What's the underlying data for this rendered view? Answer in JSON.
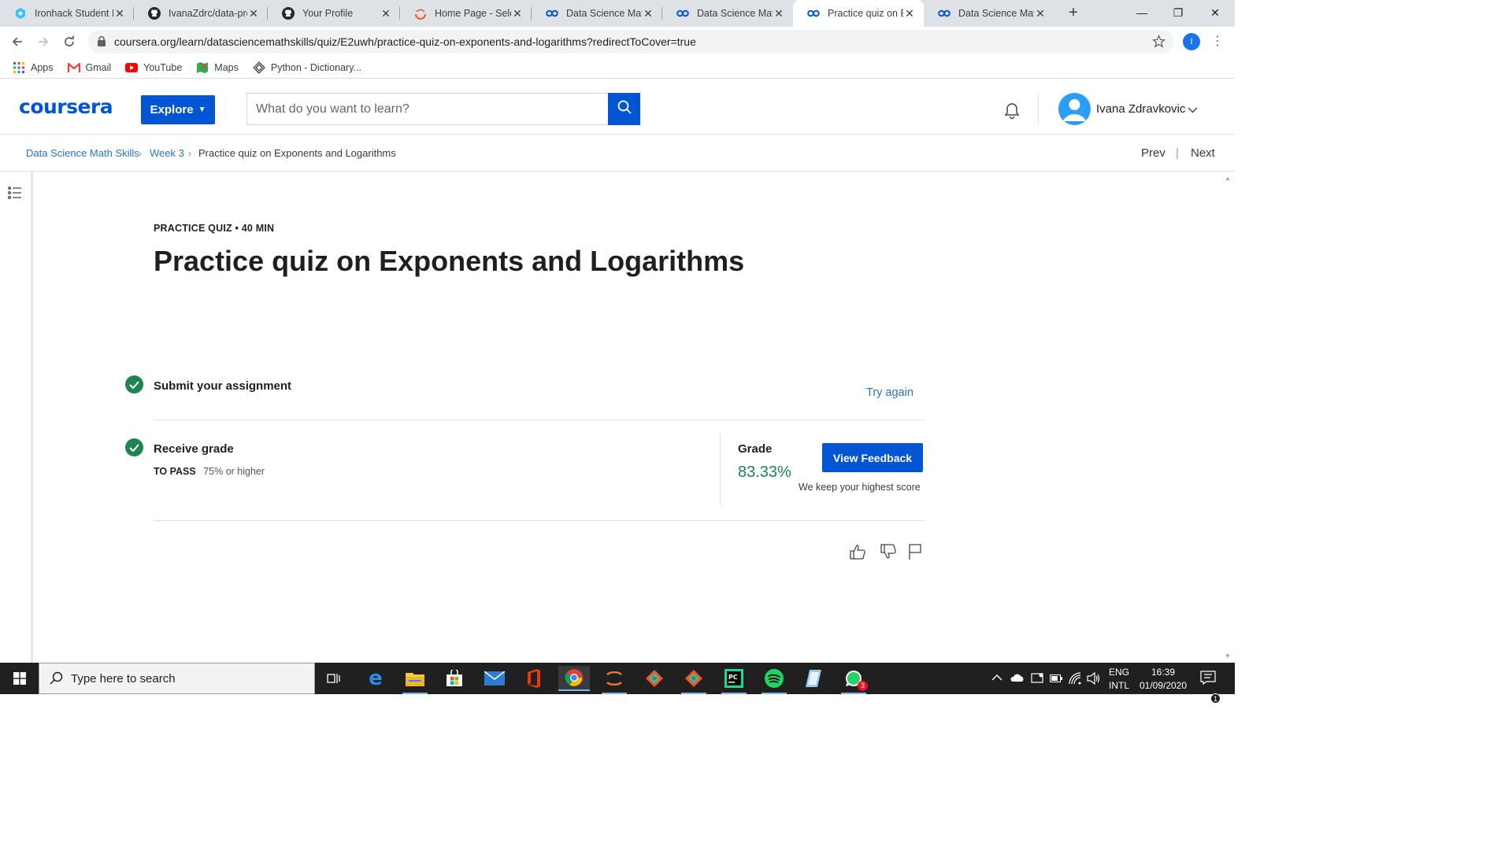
{
  "browser": {
    "tabs": [
      {
        "title": "Ironhack Student P",
        "icon": "ironhack-icon"
      },
      {
        "title": "IvanaZdrc/data-pro",
        "icon": "github-icon"
      },
      {
        "title": "Your Profile",
        "icon": "github-icon"
      },
      {
        "title": "Home Page - Selen",
        "icon": "selenium-icon"
      },
      {
        "title": "Data Science Math",
        "icon": "coursera-icon"
      },
      {
        "title": "Data Science Math",
        "icon": "coursera-icon"
      },
      {
        "title": "Practice quiz on Ex",
        "icon": "coursera-icon",
        "active": true
      },
      {
        "title": "Data Science Math",
        "icon": "coursera-icon"
      }
    ],
    "new_tab": "+",
    "url": "coursera.org/learn/datasciencemathskills/quiz/E2uwh/practice-quiz-on-exponents-and-logarithms?redirectToCover=true",
    "profile_initial": "I",
    "bookmarks": [
      "Apps",
      "Gmail",
      "YouTube",
      "Maps",
      "Python - Dictionary..."
    ]
  },
  "header": {
    "logo": "coursera",
    "explore_label": "Explore",
    "search_placeholder": "What do you want to learn?",
    "user_name": "Ivana Zdravkovic"
  },
  "breadcrumb": {
    "items": [
      "Data Science Math Skills",
      "Week 3",
      "Practice quiz on Exponents and Logarithms"
    ],
    "prev": "Prev",
    "next": "Next"
  },
  "quiz": {
    "kicker": "PRACTICE QUIZ • 40 MIN",
    "title": "Practice quiz on Exponents and Logarithms",
    "step1_title": "Submit your assignment",
    "try_again": "Try again",
    "step2_title": "Receive grade",
    "to_pass_label": "TO PASS",
    "to_pass_value": "75% or higher",
    "grade_label": "Grade",
    "grade_value": "83.33%",
    "feedback_button": "View Feedback",
    "keep_note": "We keep your highest score"
  },
  "taskbar": {
    "search_placeholder": "Type here to search",
    "lang_line1": "ENG",
    "lang_line2": "INTL",
    "time": "16:39",
    "date": "01/09/2020",
    "whatsapp_badge": "3",
    "notifications_badge": "1"
  },
  "colors": {
    "coursera_blue": "#0056d2",
    "link_blue": "#2a73cc",
    "success_green": "#1f8354",
    "taskbar": "#202020"
  }
}
